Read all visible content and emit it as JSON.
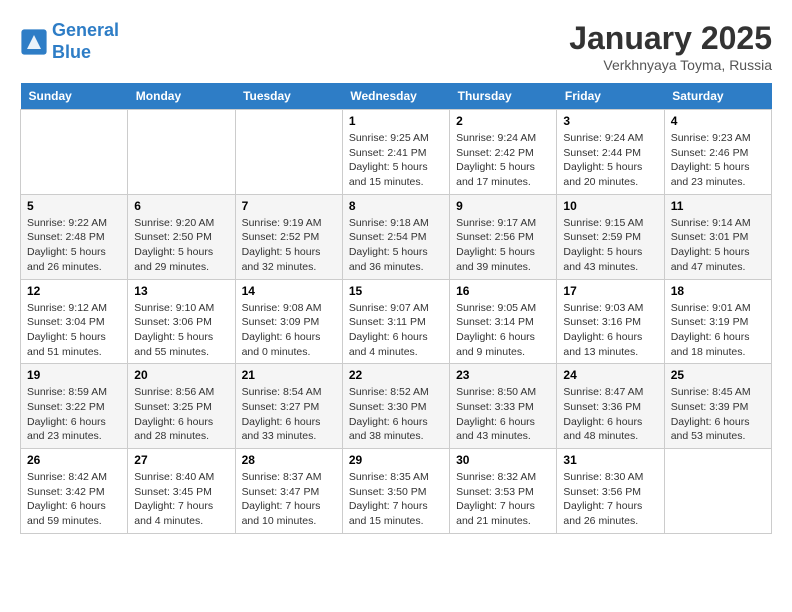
{
  "header": {
    "logo_line1": "General",
    "logo_line2": "Blue",
    "month": "January 2025",
    "location": "Verkhnyaya Toyma, Russia"
  },
  "weekdays": [
    "Sunday",
    "Monday",
    "Tuesday",
    "Wednesday",
    "Thursday",
    "Friday",
    "Saturday"
  ],
  "weeks": [
    [
      {
        "day": "",
        "info": ""
      },
      {
        "day": "",
        "info": ""
      },
      {
        "day": "",
        "info": ""
      },
      {
        "day": "1",
        "info": "Sunrise: 9:25 AM\nSunset: 2:41 PM\nDaylight: 5 hours\nand 15 minutes."
      },
      {
        "day": "2",
        "info": "Sunrise: 9:24 AM\nSunset: 2:42 PM\nDaylight: 5 hours\nand 17 minutes."
      },
      {
        "day": "3",
        "info": "Sunrise: 9:24 AM\nSunset: 2:44 PM\nDaylight: 5 hours\nand 20 minutes."
      },
      {
        "day": "4",
        "info": "Sunrise: 9:23 AM\nSunset: 2:46 PM\nDaylight: 5 hours\nand 23 minutes."
      }
    ],
    [
      {
        "day": "5",
        "info": "Sunrise: 9:22 AM\nSunset: 2:48 PM\nDaylight: 5 hours\nand 26 minutes."
      },
      {
        "day": "6",
        "info": "Sunrise: 9:20 AM\nSunset: 2:50 PM\nDaylight: 5 hours\nand 29 minutes."
      },
      {
        "day": "7",
        "info": "Sunrise: 9:19 AM\nSunset: 2:52 PM\nDaylight: 5 hours\nand 32 minutes."
      },
      {
        "day": "8",
        "info": "Sunrise: 9:18 AM\nSunset: 2:54 PM\nDaylight: 5 hours\nand 36 minutes."
      },
      {
        "day": "9",
        "info": "Sunrise: 9:17 AM\nSunset: 2:56 PM\nDaylight: 5 hours\nand 39 minutes."
      },
      {
        "day": "10",
        "info": "Sunrise: 9:15 AM\nSunset: 2:59 PM\nDaylight: 5 hours\nand 43 minutes."
      },
      {
        "day": "11",
        "info": "Sunrise: 9:14 AM\nSunset: 3:01 PM\nDaylight: 5 hours\nand 47 minutes."
      }
    ],
    [
      {
        "day": "12",
        "info": "Sunrise: 9:12 AM\nSunset: 3:04 PM\nDaylight: 5 hours\nand 51 minutes."
      },
      {
        "day": "13",
        "info": "Sunrise: 9:10 AM\nSunset: 3:06 PM\nDaylight: 5 hours\nand 55 minutes."
      },
      {
        "day": "14",
        "info": "Sunrise: 9:08 AM\nSunset: 3:09 PM\nDaylight: 6 hours\nand 0 minutes."
      },
      {
        "day": "15",
        "info": "Sunrise: 9:07 AM\nSunset: 3:11 PM\nDaylight: 6 hours\nand 4 minutes."
      },
      {
        "day": "16",
        "info": "Sunrise: 9:05 AM\nSunset: 3:14 PM\nDaylight: 6 hours\nand 9 minutes."
      },
      {
        "day": "17",
        "info": "Sunrise: 9:03 AM\nSunset: 3:16 PM\nDaylight: 6 hours\nand 13 minutes."
      },
      {
        "day": "18",
        "info": "Sunrise: 9:01 AM\nSunset: 3:19 PM\nDaylight: 6 hours\nand 18 minutes."
      }
    ],
    [
      {
        "day": "19",
        "info": "Sunrise: 8:59 AM\nSunset: 3:22 PM\nDaylight: 6 hours\nand 23 minutes."
      },
      {
        "day": "20",
        "info": "Sunrise: 8:56 AM\nSunset: 3:25 PM\nDaylight: 6 hours\nand 28 minutes."
      },
      {
        "day": "21",
        "info": "Sunrise: 8:54 AM\nSunset: 3:27 PM\nDaylight: 6 hours\nand 33 minutes."
      },
      {
        "day": "22",
        "info": "Sunrise: 8:52 AM\nSunset: 3:30 PM\nDaylight: 6 hours\nand 38 minutes."
      },
      {
        "day": "23",
        "info": "Sunrise: 8:50 AM\nSunset: 3:33 PM\nDaylight: 6 hours\nand 43 minutes."
      },
      {
        "day": "24",
        "info": "Sunrise: 8:47 AM\nSunset: 3:36 PM\nDaylight: 6 hours\nand 48 minutes."
      },
      {
        "day": "25",
        "info": "Sunrise: 8:45 AM\nSunset: 3:39 PM\nDaylight: 6 hours\nand 53 minutes."
      }
    ],
    [
      {
        "day": "26",
        "info": "Sunrise: 8:42 AM\nSunset: 3:42 PM\nDaylight: 6 hours\nand 59 minutes."
      },
      {
        "day": "27",
        "info": "Sunrise: 8:40 AM\nSunset: 3:45 PM\nDaylight: 7 hours\nand 4 minutes."
      },
      {
        "day": "28",
        "info": "Sunrise: 8:37 AM\nSunset: 3:47 PM\nDaylight: 7 hours\nand 10 minutes."
      },
      {
        "day": "29",
        "info": "Sunrise: 8:35 AM\nSunset: 3:50 PM\nDaylight: 7 hours\nand 15 minutes."
      },
      {
        "day": "30",
        "info": "Sunrise: 8:32 AM\nSunset: 3:53 PM\nDaylight: 7 hours\nand 21 minutes."
      },
      {
        "day": "31",
        "info": "Sunrise: 8:30 AM\nSunset: 3:56 PM\nDaylight: 7 hours\nand 26 minutes."
      },
      {
        "day": "",
        "info": ""
      }
    ]
  ]
}
